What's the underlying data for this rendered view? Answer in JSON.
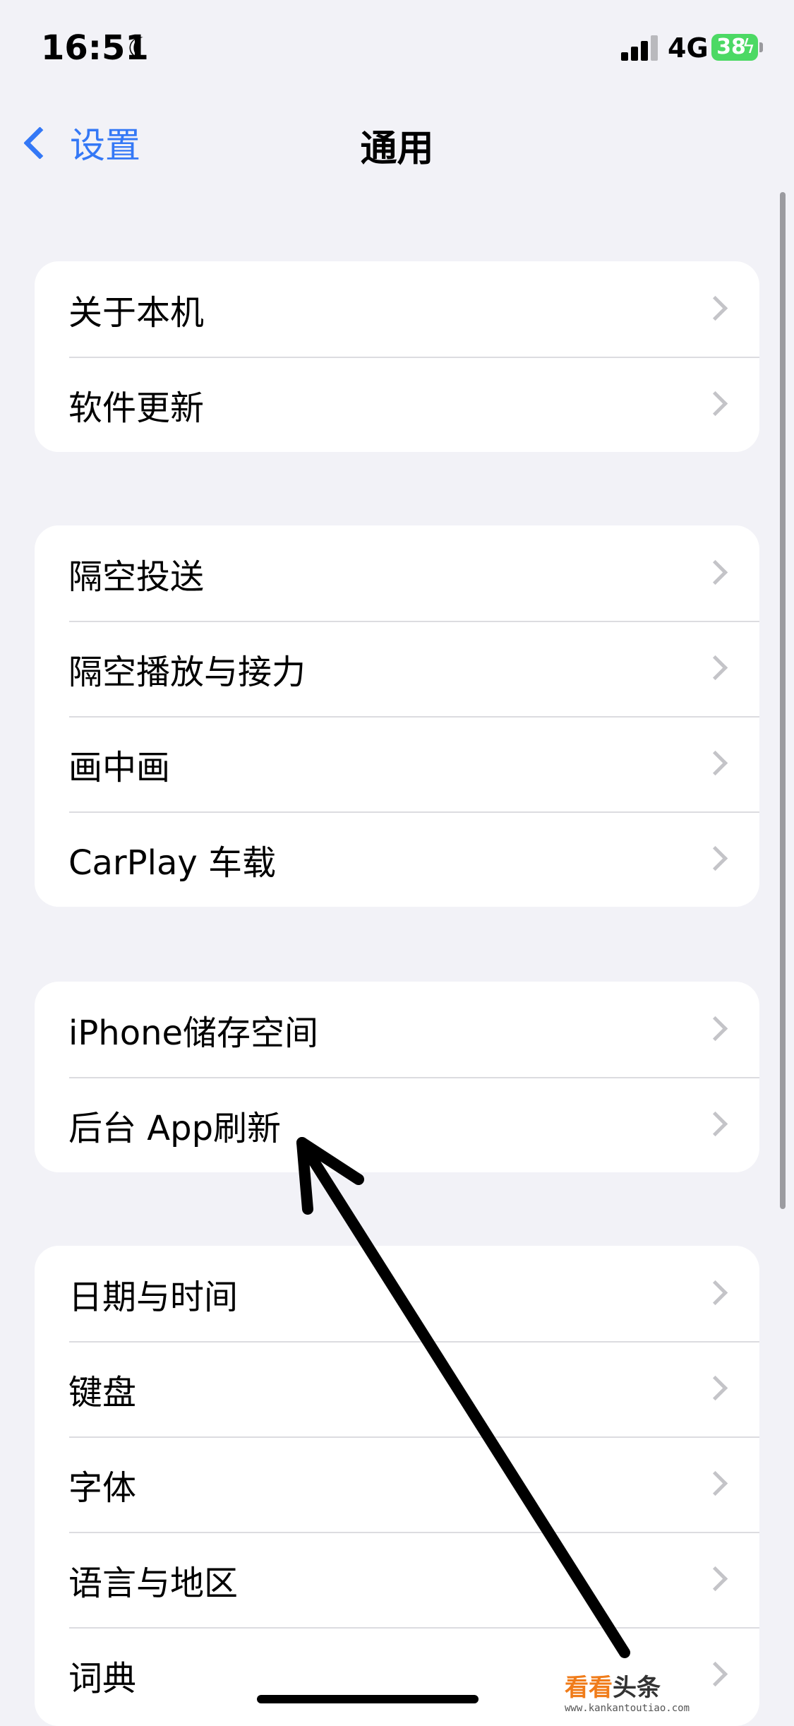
{
  "status_bar": {
    "time": "16:51",
    "network": "4G",
    "battery": "38"
  },
  "nav": {
    "back_label": "设置",
    "title": "通用"
  },
  "groups": [
    {
      "items": [
        "关于本机",
        "软件更新"
      ]
    },
    {
      "items": [
        "隔空投送",
        "隔空播放与接力",
        "画中画",
        "CarPlay 车载"
      ]
    },
    {
      "items": [
        "iPhone储存空间",
        "后台 App刷新"
      ]
    },
    {
      "items": [
        "日期与时间",
        "键盘",
        "字体",
        "语言与地区",
        "词典"
      ]
    }
  ],
  "watermark": {
    "part1": "看看",
    "part2": "头条",
    "url": "www.kankantoutiao.com"
  },
  "colors": {
    "accent": "#3478f6",
    "background": "#f2f2f7",
    "battery": "#4cd964"
  }
}
